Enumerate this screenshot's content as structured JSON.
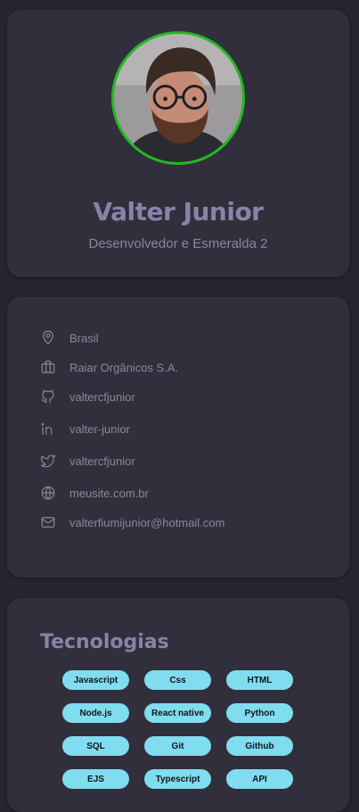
{
  "profile": {
    "name": "Valter Junior",
    "role": "Desenvolvedor e Esmeralda 2",
    "avatar_border_color": "#22b922"
  },
  "info": {
    "items": [
      {
        "icon": "location-pin-icon",
        "label": "Brasil"
      },
      {
        "icon": "briefcase-icon",
        "label": "Raiar Orgânicos S.A."
      },
      {
        "icon": "github-icon",
        "label": "valtercfjunior"
      },
      {
        "icon": "linkedin-icon",
        "label": "valter-junior"
      },
      {
        "icon": "twitter-icon",
        "label": "valtercfjunior"
      },
      {
        "icon": "globe-icon",
        "label": "meusite.com.br"
      },
      {
        "icon": "mail-icon",
        "label": "valterfiumijunior@hotmail.com"
      }
    ]
  },
  "technologies": {
    "title": "Tecnologias",
    "chip_color": "#80dcef",
    "items": [
      "Javascript",
      "Css",
      "HTML",
      "Node.js",
      "React native",
      "Python",
      "SQL",
      "Git",
      "Github",
      "EJS",
      "Typescript",
      "API"
    ]
  }
}
